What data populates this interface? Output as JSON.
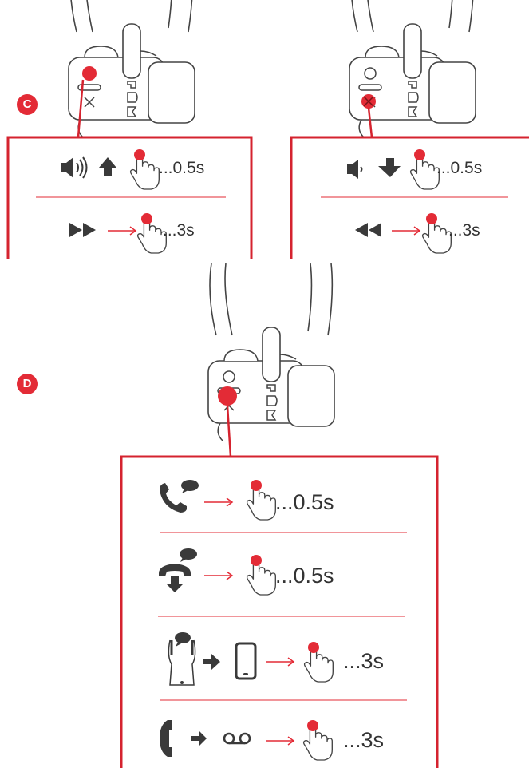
{
  "colors": {
    "accent": "#e32b36",
    "line": "#333333",
    "icon": "#3a3a3a",
    "panel_border": "#d5232f"
  },
  "section_c": {
    "badge": "C",
    "left_panel": {
      "row1": {
        "icons": [
          "speaker-loud-icon",
          "arrow-up-icon",
          "finger-press-icon"
        ],
        "duration": "...0.5s"
      },
      "row2": {
        "icons": [
          "fast-forward-icon",
          "arrow-right-icon",
          "finger-press-icon"
        ],
        "duration": "...3s"
      }
    },
    "right_panel": {
      "row1": {
        "icons": [
          "speaker-quiet-icon",
          "arrow-down-icon",
          "finger-press-icon"
        ],
        "duration": "...0.5s"
      },
      "row2": {
        "icons": [
          "rewind-icon",
          "arrow-right-icon",
          "finger-press-icon"
        ],
        "duration": "...3s"
      }
    }
  },
  "section_d": {
    "badge": "D",
    "rows": [
      {
        "icons": [
          "answer-call-icon",
          "arrow-right-icon",
          "finger-press-icon"
        ],
        "duration": "...0.5s"
      },
      {
        "icons": [
          "end-call-icon",
          "arrow-right-icon",
          "finger-press-icon"
        ],
        "duration": "...0.5s"
      },
      {
        "icons": [
          "headset-icon",
          "arrow-right-icon",
          "phone-icon",
          "arrow-right-icon",
          "finger-press-icon"
        ],
        "duration": "...3s"
      },
      {
        "icons": [
          "handset-icon",
          "arrow-right-icon",
          "voicemail-icon",
          "arrow-right-icon",
          "finger-press-icon"
        ],
        "duration": "...3s"
      }
    ]
  }
}
